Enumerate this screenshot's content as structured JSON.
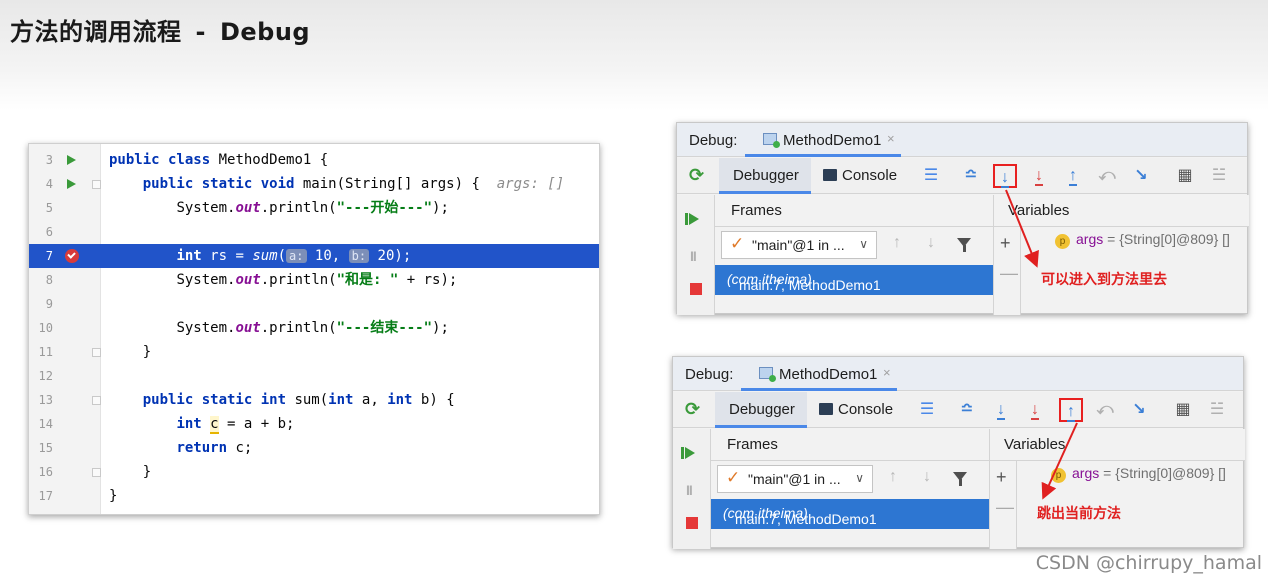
{
  "slide": {
    "title": "方法的调用流程",
    "separator": "-",
    "subtitle": "Debug"
  },
  "editor": {
    "lines": [
      {
        "num": "3"
      },
      {
        "num": "4"
      },
      {
        "num": "5"
      },
      {
        "num": "6"
      },
      {
        "num": "7"
      },
      {
        "num": "8"
      },
      {
        "num": "9"
      },
      {
        "num": "10"
      },
      {
        "num": "11"
      },
      {
        "num": "12"
      },
      {
        "num": "13"
      },
      {
        "num": "14"
      },
      {
        "num": "15"
      },
      {
        "num": "16"
      },
      {
        "num": "17"
      }
    ],
    "code": {
      "l3_kw": "public class",
      "l3_rest": " MethodDemo1 {",
      "l4_kw": "public static void",
      "l4_rest": " main(String[] args) {  ",
      "l4_hint": "args: []",
      "l5_a": "System.",
      "l5_fld": "out",
      "l5_b": ".println(",
      "l5_str": "\"---开始---\"",
      "l5_c": ");",
      "l7_kw": "int",
      "l7_a": " rs = ",
      "l7_call": "sum",
      "l7_b": "(",
      "l7_ph1": "a:",
      "l7_c": " 10, ",
      "l7_ph2": "b:",
      "l7_d": " 20);",
      "l8_a": "System.",
      "l8_fld": "out",
      "l8_b": ".println(",
      "l8_str": "\"和是: \"",
      "l8_c": " + rs);",
      "l10_a": "System.",
      "l10_fld": "out",
      "l10_b": ".println(",
      "l10_str": "\"---结束---\"",
      "l10_c": ");",
      "l11": "}",
      "l13_kw1": "public static int",
      "l13_a": " sum(",
      "l13_kw2": "int",
      "l13_b": " a, ",
      "l13_kw3": "int",
      "l13_c": " b) {",
      "l14_kw": "int",
      "l14_a": " ",
      "l14_c": "c",
      "l14_b": " = a + b;",
      "l15_kw": "return",
      "l15_a": " c;",
      "l16": "}",
      "l17": "}"
    }
  },
  "debug_panels": [
    {
      "label": "Debug:",
      "tab": "MethodDemo1",
      "tab_close": "×",
      "debugger_tab": "Debugger",
      "console_tab": "Console",
      "frames": "Frames",
      "variables": "Variables",
      "thread": "\"main\"@1 in ...",
      "frame": "main:7, MethodDemo1 ",
      "frame_pkg": "(com.itheima)",
      "var_name": "args",
      "var_value": " = {String[0]@809} []",
      "annotation": "可以进入到方法里去",
      "highlighted_action": "step-into"
    },
    {
      "label": "Debug:",
      "tab": "MethodDemo1",
      "tab_close": "×",
      "debugger_tab": "Debugger",
      "console_tab": "Console",
      "frames": "Frames",
      "variables": "Variables",
      "thread": "\"main\"@1 in ...",
      "frame": "main:7, MethodDemo1 ",
      "frame_pkg": "(com.itheima)",
      "var_name": "args",
      "var_value": " = {String[0]@809} []",
      "annotation": "跳出当前方法",
      "highlighted_action": "step-out"
    }
  ],
  "colors": {
    "highlight_line": "#2154c9",
    "selected_frame": "#2d76d2",
    "annotation_red": "#e02020",
    "tab_accent": "#4a88e8"
  },
  "watermark": "CSDN @chirrupy_hamal"
}
